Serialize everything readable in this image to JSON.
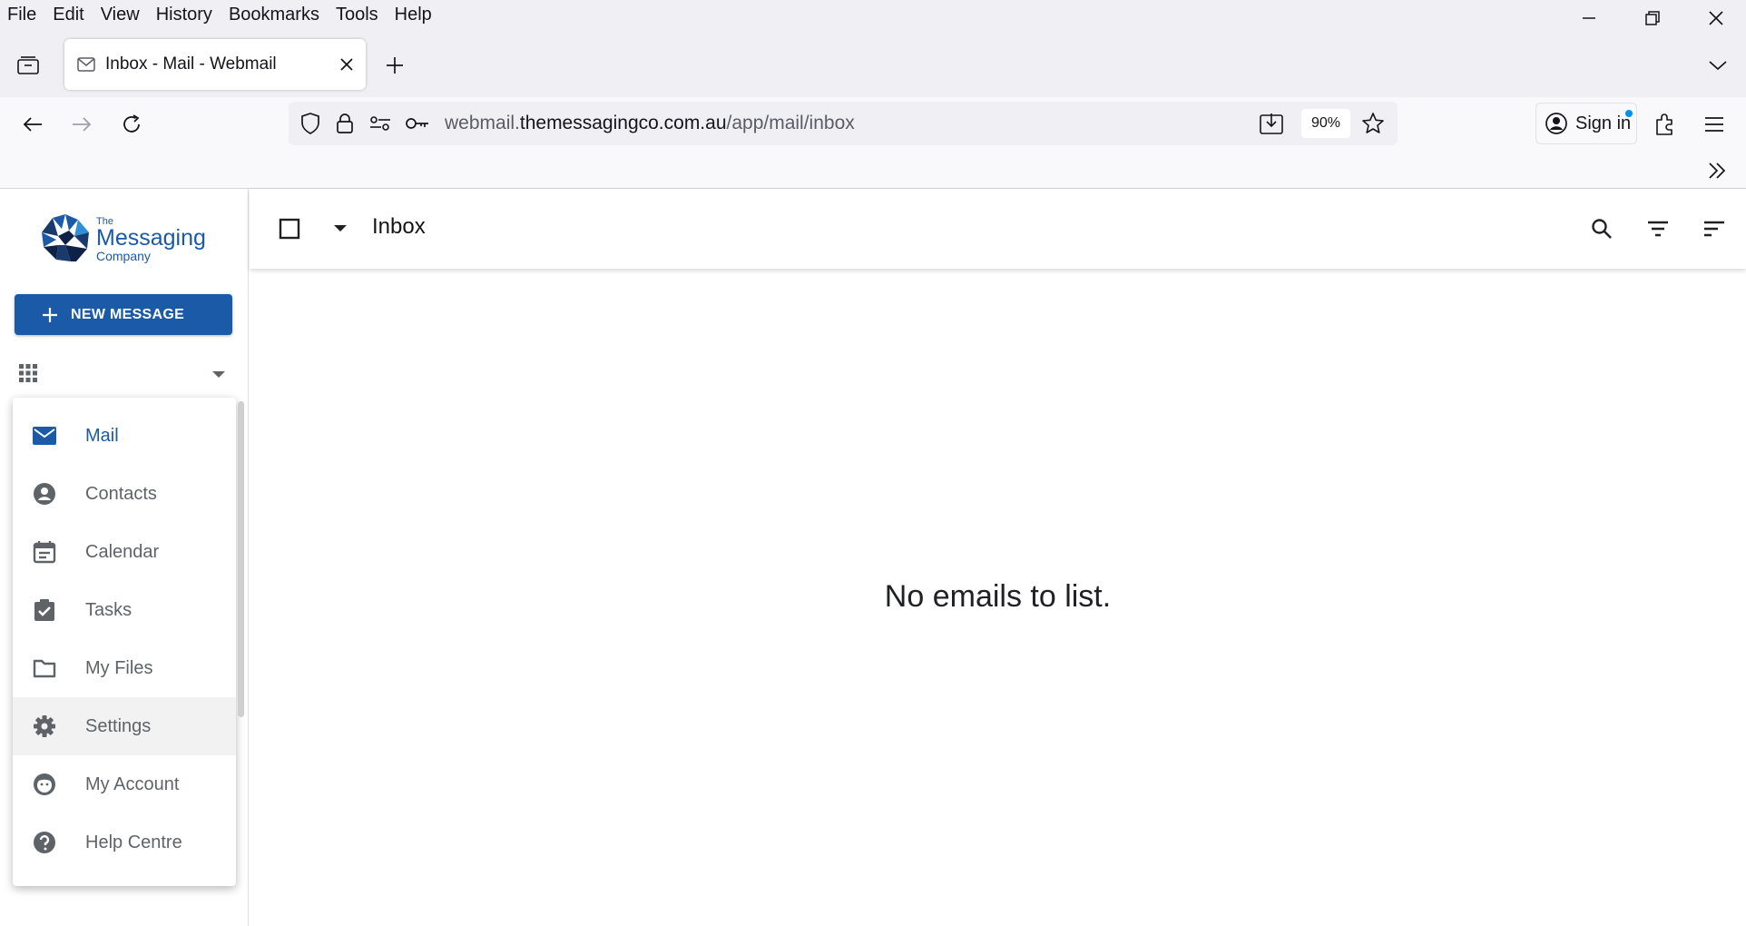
{
  "browser": {
    "menu": [
      "File",
      "Edit",
      "View",
      "History",
      "Bookmarks",
      "Tools",
      "Help"
    ],
    "tab": {
      "title": "Inbox - Mail - Webmail",
      "icon": "mail-icon"
    },
    "url": {
      "prefix": "webmail.",
      "domain": "themessagingco.com.au",
      "path": "/app/mail/inbox"
    },
    "zoom": "90%",
    "signin_label": "Sign in"
  },
  "app": {
    "logo": {
      "small": "The",
      "main": "Messaging",
      "sub": "Company"
    },
    "new_message_label": "NEW MESSAGE",
    "apps_menu": [
      {
        "label": "Mail",
        "icon": "mail-icon",
        "active": true
      },
      {
        "label": "Contacts",
        "icon": "contact-icon"
      },
      {
        "label": "Calendar",
        "icon": "calendar-icon"
      },
      {
        "label": "Tasks",
        "icon": "tasks-icon"
      },
      {
        "label": "My Files",
        "icon": "folder-icon"
      },
      {
        "label": "Settings",
        "icon": "gear-icon",
        "hover": true
      },
      {
        "label": "My Account",
        "icon": "account-icon"
      },
      {
        "label": "Help Centre",
        "icon": "help-icon"
      }
    ],
    "folder_title": "Inbox",
    "empty_message": "No emails to list.",
    "colors": {
      "brand": "#1a5aa6",
      "icon_grey": "#5f6368"
    }
  }
}
